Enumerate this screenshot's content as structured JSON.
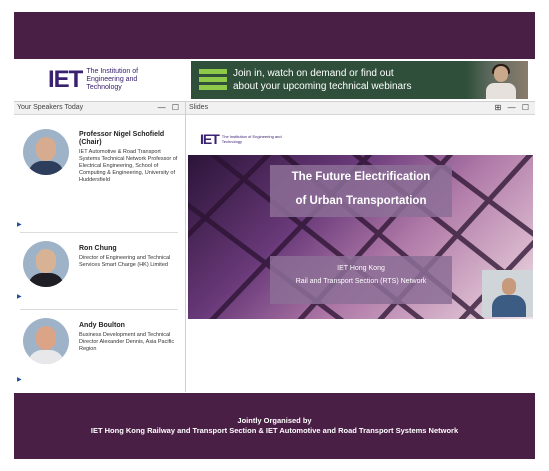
{
  "header": {
    "logo_mark": "IET",
    "logo_text": "The Institution of Engineering and Technology",
    "banner_line1": "Join in, watch on demand or find out",
    "banner_line2": "about your upcoming technical webinars"
  },
  "speakers_panel": {
    "title": "Your Speakers Today",
    "controls": "— ☐",
    "speakers": [
      {
        "name": "Professor Nigel Schofield (Chair)",
        "desc": "IET Automotive & Road Transport Systems Technical Network Professor of Electrical Engineering, School of Computing & Engineering, University of Huddersfield"
      },
      {
        "name": "Ron Chung",
        "desc": "Director of Engineering and Technical Services Smart Charge (HK) Limited"
      },
      {
        "name": "Andy Boulton",
        "desc": "Business Development and Technical Director Alexander Dennis, Asia Pacific Region"
      }
    ]
  },
  "slides_panel": {
    "title": "Slides",
    "controls": "⊞ — ☐",
    "logo_mark": "IET",
    "logo_text": "The Institution of Engineering and Technology",
    "slide_title_line1": "The Future Electrification",
    "slide_title_line2": "of Urban Transportation",
    "slide_sub_line1": "IET Hong Kong",
    "slide_sub_line2": "Rail and Transport Section (RTS) Network"
  },
  "footer": {
    "line1": "Jointly Organised by",
    "line2": "IET Hong Kong Railway and Transport Section & IET Automotive and Road Transport Systems Network"
  },
  "icons": {
    "play": "play-triangle-icon"
  },
  "colors": {
    "brand_purple": "#4a1f45",
    "banner_green": "#2f4f3a",
    "accent_green": "#8fc94a",
    "iet_navy": "#3a2070"
  }
}
